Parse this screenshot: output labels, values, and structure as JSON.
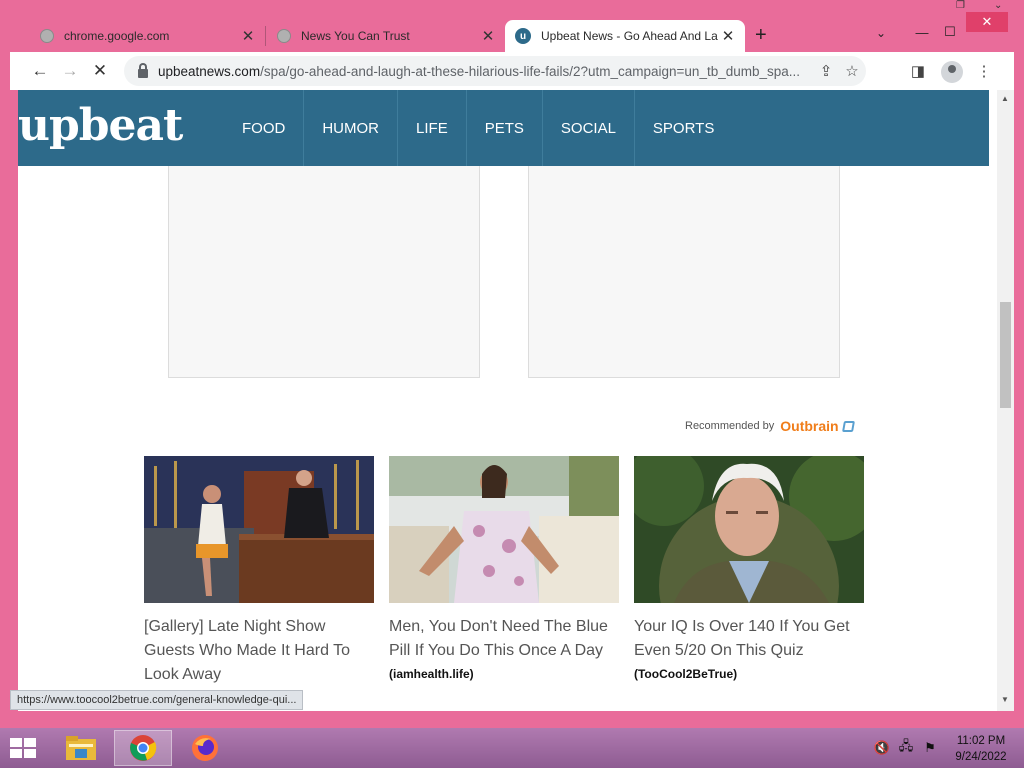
{
  "browser": {
    "tabs": [
      {
        "title": "chrome.google.com",
        "active": false
      },
      {
        "title": "News You Can Trust",
        "active": false
      },
      {
        "title": "Upbeat News - Go Ahead And La",
        "active": true
      }
    ],
    "url_host": "upbeatnews.com",
    "url_path": "/spa/go-ahead-and-laugh-at-these-hilarious-life-fails/2?utm_campaign=un_tb_dumb_spa...",
    "status_url": "https://www.toocool2betrue.com/general-knowledge-qui..."
  },
  "site": {
    "logo": "upbeat",
    "nav": [
      "FOOD",
      "HUMOR",
      "LIFE",
      "PETS",
      "SOCIAL",
      "SPORTS"
    ],
    "recommended_by": "Recommended by",
    "outbrain": "Outbrain"
  },
  "cards": [
    {
      "headline": "[Gallery] Late Night Show Guests Who Made It Hard To Look Away",
      "source": ""
    },
    {
      "headline": "Men, You Don't Need The Blue Pill If You Do This Once A Day",
      "source": "(iamhealth.life)"
    },
    {
      "headline": "Your IQ Is Over 140 If You Get Even 5/20 On This Quiz",
      "source": "(TooCool2BeTrue)"
    }
  ],
  "taskbar": {
    "time": "11:02 PM",
    "date": "9/24/2022"
  },
  "colors": {
    "frame": "#e96c9a",
    "nav_bg": "#2d6a8a",
    "close_btn": "#e0406a",
    "outbrain_orange": "#f07d1a"
  }
}
